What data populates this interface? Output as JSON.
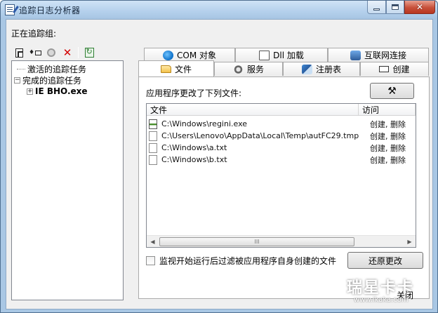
{
  "window": {
    "title": "追踪日志分析器",
    "close_glyph": "✕"
  },
  "left_pane": {
    "group_label": "正在追踪组:",
    "toolbar": {
      "new_icon": "new-trace-icon",
      "add_icon": "add-trace-icon",
      "stop_icon": "stop-icon",
      "delete_icon": "delete-icon",
      "delete_glyph": "✕",
      "refresh_icon": "refresh-icon"
    },
    "tree": {
      "active_tasks": "激活的追踪任务",
      "completed_tasks": "完成的追踪任务",
      "expander_symbol": "−",
      "child_expander_symbol": "+",
      "child_item": "IE BHO.exe"
    }
  },
  "tabs": {
    "row1": [
      {
        "label": "COM 对象",
        "icon": "globe-icon"
      },
      {
        "label": "Dll 加载",
        "icon": "dll-icon"
      },
      {
        "label": "互联网连接",
        "icon": "network-icon"
      }
    ],
    "row2": [
      {
        "label": "文件",
        "icon": "folder-icon",
        "active": true
      },
      {
        "label": "服务",
        "icon": "gear-icon"
      },
      {
        "label": "注册表",
        "icon": "registry-icon"
      },
      {
        "label": "创建",
        "icon": "create-icon"
      }
    ]
  },
  "files_panel": {
    "label": "应用程序更改了下列文件:",
    "tools_glyph": "⚒",
    "columns": [
      "文件",
      "访问"
    ],
    "rows": [
      {
        "path": "C:\\Windows\\regini.exe",
        "access": "创建, 删除",
        "type": "exe"
      },
      {
        "path": "C:\\Users\\Lenovo\\AppData\\Local\\Temp\\autFC29.tmp",
        "access": "创建, 删除",
        "type": "file"
      },
      {
        "path": "C:\\Windows\\a.txt",
        "access": "创建, 删除",
        "type": "file"
      },
      {
        "path": "C:\\Windows\\b.txt",
        "access": "创建, 删除",
        "type": "file"
      }
    ],
    "scroll": {
      "left_arrow": "◀",
      "right_arrow": "▶",
      "thumb_grip": "III"
    },
    "checkbox_label": "监视开始运行后过滤被应用程序自身创建的文件",
    "checkbox_checked": false,
    "restore_button": "还原更改"
  },
  "close_button": "关闭",
  "watermark": {
    "logo": "瑞星卡卡",
    "url": "www.ikaka.com"
  }
}
